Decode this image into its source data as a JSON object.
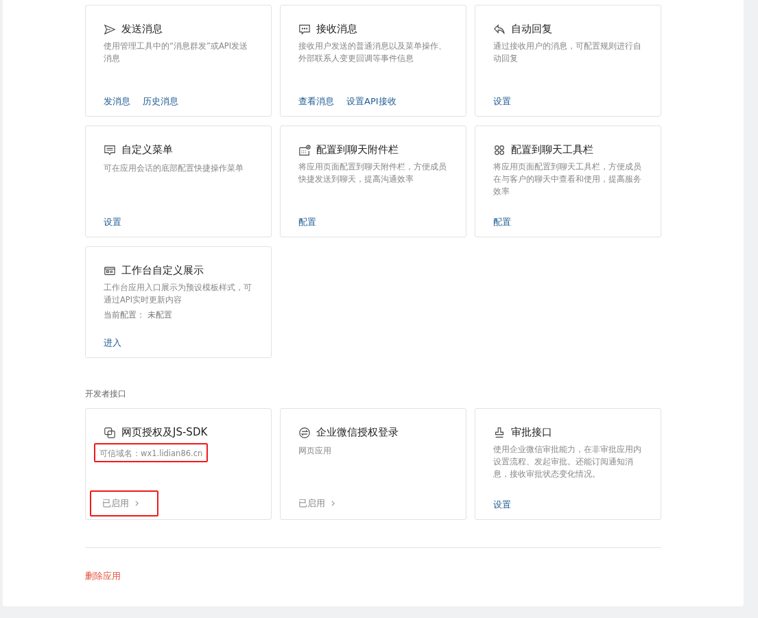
{
  "sections": [
    {
      "cards": [
        {
          "title": "发送消息",
          "description": "使用管理工具中的“消息群发”或API发送消息",
          "actions": [
            {
              "kind": "link",
              "label": "发消息"
            },
            {
              "kind": "link",
              "label": "历史消息"
            }
          ]
        },
        {
          "title": "接收消息",
          "description": "接收用户发送的普通消息以及菜单操作、外部联系人变更回调等事件信息",
          "actions": [
            {
              "kind": "link",
              "label": "查看消息"
            },
            {
              "kind": "link",
              "label": "设置API接收"
            }
          ]
        },
        {
          "title": "自动回复",
          "description": "通过接收用户的消息，可配置规则进行自动回复",
          "actions": [
            {
              "kind": "link",
              "label": "设置"
            }
          ]
        },
        {
          "title": "自定义菜单",
          "description": "可在应用会话的底部配置快捷操作菜单",
          "actions": [
            {
              "kind": "link",
              "label": "设置"
            }
          ]
        },
        {
          "title": "配置到聊天附件栏",
          "description": "将应用页面配置到聊天附件栏，方便成员快捷发送到聊天，提高沟通效率",
          "actions": [
            {
              "kind": "link",
              "label": "配置"
            }
          ]
        },
        {
          "title": "配置到聊天工具栏",
          "description": "将应用页面配置到聊天工具栏，方便成员在与客户的聊天中查看和使用，提高服务效率",
          "actions": [
            {
              "kind": "link",
              "label": "配置"
            }
          ]
        },
        {
          "title": "工作台自定义展示",
          "description": "工作台应用入口展示为预设模板样式，可通过API实时更新内容",
          "note": "当前配置： 未配置",
          "actions": [
            {
              "kind": "link",
              "label": "进入"
            }
          ]
        }
      ]
    },
    {
      "heading": "开发者接口",
      "cards": [
        {
          "title": "网页授权及JS-SDK",
          "description": "可信域名：wx1.lidian86.cn",
          "description_highlighted": true,
          "actions": [
            {
              "kind": "status",
              "label": "已启用",
              "highlighted": true
            }
          ]
        },
        {
          "title": "企业微信授权登录",
          "description": "网页应用",
          "description_highlighted": false,
          "actions": [
            {
              "kind": "status",
              "label": "已启用",
              "highlighted": false
            }
          ]
        },
        {
          "title": "审批接口",
          "description": "使用企业微信审批能力，在非审批应用内设置流程、发起审批。还能订阅通知消息，接收审批状态变化情况。",
          "description_highlighted": false,
          "actions": [
            {
              "kind": "link",
              "label": "设置"
            }
          ]
        }
      ]
    }
  ],
  "delete_link": "删除应用"
}
